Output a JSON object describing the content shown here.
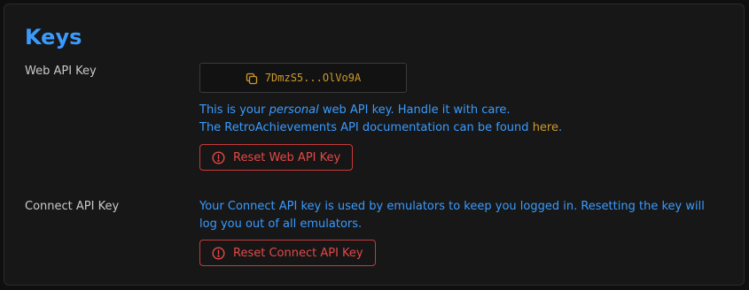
{
  "section": {
    "title": "Keys"
  },
  "web_api": {
    "label": "Web API Key",
    "key_value": "7DmzS5...OlVo9A",
    "copy_icon": "copy-icon",
    "desc_line1_prefix": "This is your ",
    "desc_line1_emphasis": "personal",
    "desc_line1_suffix": " web API key. Handle it with care.",
    "desc_line2_prefix": "The RetroAchievements API documentation can be found ",
    "desc_line2_link": "here",
    "desc_line2_suffix": ".",
    "reset_label": "Reset Web API Key",
    "reset_icon": "alert-circle-icon"
  },
  "connect_api": {
    "label": "Connect API Key",
    "desc_line1": "Your Connect API key is used by emulators to keep you logged in. Resetting the key will",
    "desc_line2": "log you out of all emulators.",
    "reset_label": "Reset Connect API Key",
    "reset_icon": "alert-circle-icon"
  },
  "colors": {
    "accent_blue": "#3a9bff",
    "key_gold": "#cc9a2e",
    "danger_red": "#e64848",
    "panel_bg": "#171717"
  }
}
